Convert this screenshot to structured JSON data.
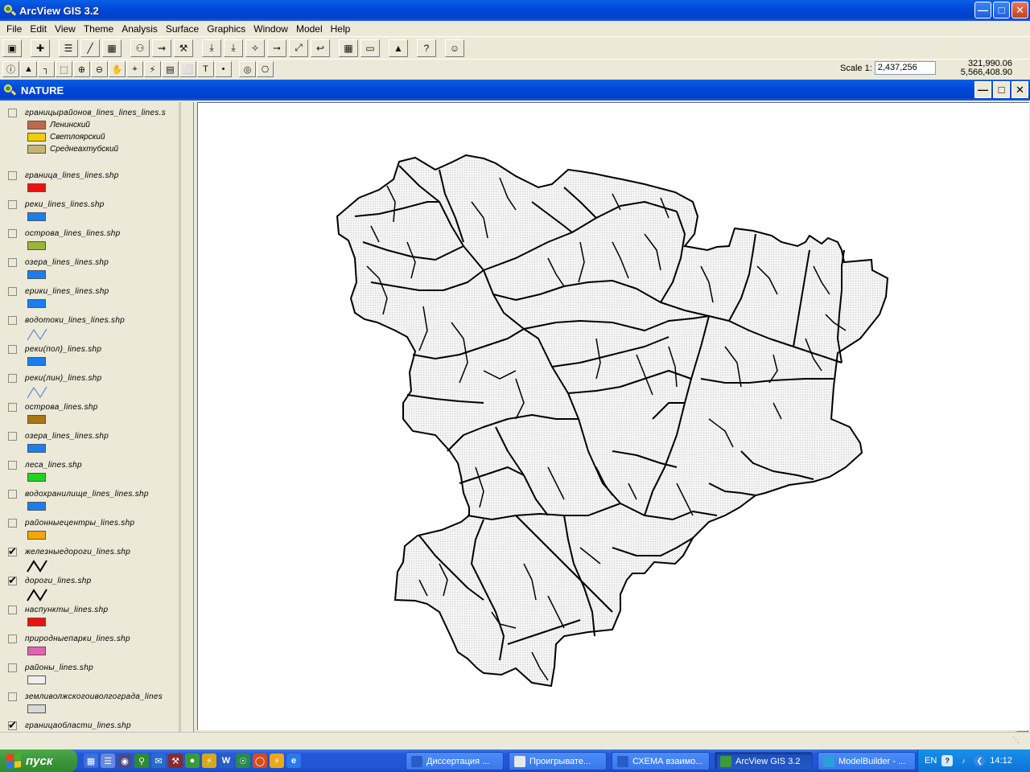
{
  "app": {
    "title": "ArcView GIS 3.2"
  },
  "menu": [
    "File",
    "Edit",
    "View",
    "Theme",
    "Analysis",
    "Surface",
    "Graphics",
    "Window",
    "Model",
    "Help"
  ],
  "toolbar1": [
    {
      "name": "save-icon",
      "glyph": "▣"
    },
    {
      "name": "add-theme-icon",
      "glyph": "✚"
    },
    {
      "name": "theme-properties-icon",
      "glyph": "☰"
    },
    {
      "name": "edit-legend-icon",
      "glyph": "╱"
    },
    {
      "name": "open-table-icon",
      "glyph": "▦"
    },
    {
      "name": "find-icon",
      "glyph": "⚇"
    },
    {
      "name": "locate-address-icon",
      "glyph": "⇝"
    },
    {
      "name": "query-builder-icon",
      "glyph": "⚒"
    },
    {
      "name": "zoom-full-extent-icon",
      "glyph": "⤓"
    },
    {
      "name": "zoom-active-themes-icon",
      "glyph": "⤓"
    },
    {
      "name": "zoom-selected-icon",
      "glyph": "✧"
    },
    {
      "name": "zoom-in-fixed-icon",
      "glyph": "⭢"
    },
    {
      "name": "zoom-out-fixed-icon",
      "glyph": "⤢"
    },
    {
      "name": "zoom-previous-icon",
      "glyph": "↩"
    },
    {
      "name": "select-by-theme-icon",
      "glyph": "▦"
    },
    {
      "name": "clear-selection-icon",
      "glyph": "▭"
    },
    {
      "name": "create-chart-icon",
      "glyph": "▲"
    },
    {
      "name": "help-icon",
      "glyph": "?"
    },
    {
      "name": "hotlink-icon",
      "glyph": "☺"
    }
  ],
  "toolbar2": [
    {
      "name": "identify-icon",
      "glyph": "ⓘ"
    },
    {
      "name": "pointer-icon",
      "glyph": "▲"
    },
    {
      "name": "vertex-edit-icon",
      "glyph": "┐"
    },
    {
      "name": "select-feature-icon",
      "glyph": "⬚"
    },
    {
      "name": "zoom-in-icon",
      "glyph": "⊕"
    },
    {
      "name": "zoom-out-icon",
      "glyph": "⊖"
    },
    {
      "name": "pan-icon",
      "glyph": "✋"
    },
    {
      "name": "measure-icon",
      "glyph": "⌖"
    },
    {
      "name": "hotlink-bolt-icon",
      "glyph": "⚡"
    },
    {
      "name": "area-of-interest-icon",
      "glyph": "▤"
    },
    {
      "name": "label-icon",
      "glyph": "⬜"
    },
    {
      "name": "text-icon",
      "glyph": "T"
    },
    {
      "name": "draw-point-icon",
      "glyph": "•"
    },
    {
      "name": "snap-icon",
      "glyph": "◎"
    },
    {
      "name": "snap-general-icon",
      "glyph": "⎔"
    }
  ],
  "scale": {
    "label": "Scale 1:",
    "value": "2,437,256"
  },
  "coords": {
    "x": "321,990.06",
    "y": "5,566,408.90"
  },
  "view": {
    "title": "NATURE"
  },
  "themes": [
    {
      "name": "границырайонов_lines_lines_lines.s",
      "checked": false,
      "type": "poly-legend",
      "legend": [
        {
          "label": "Ленинский",
          "color": "#c0684e"
        },
        {
          "label": "Светлоярский",
          "color": "#f5cc00"
        },
        {
          "label": "Среднеахтубский",
          "color": "#c8b46c"
        }
      ]
    },
    {
      "name": "граница_lines_lines.shp",
      "checked": false,
      "type": "poly",
      "color": "#ee1111"
    },
    {
      "name": "реки_lines_lines.shp",
      "checked": false,
      "type": "poly",
      "color": "#1a7ef0"
    },
    {
      "name": "острова_lines_lines.shp",
      "checked": false,
      "type": "poly",
      "color": "#9ab43a"
    },
    {
      "name": "озера_lines_lines.shp",
      "checked": false,
      "type": "poly",
      "color": "#1a7ef0"
    },
    {
      "name": "ерики_lines_lines.shp",
      "checked": false,
      "type": "poly",
      "color": "#1a7ef0"
    },
    {
      "name": "водотоки_lines_lines.shp",
      "checked": false,
      "type": "line",
      "color": "#3a7ad8"
    },
    {
      "name": "реки(пол)_lines.shp",
      "checked": false,
      "type": "poly",
      "color": "#1a7ef0"
    },
    {
      "name": "реки(лин)_lines.shp",
      "checked": false,
      "type": "line",
      "color": "#3a7ad8"
    },
    {
      "name": "острова_lines.shp",
      "checked": false,
      "type": "poly",
      "color": "#a87814"
    },
    {
      "name": "озера_lines_lines.shp",
      "checked": false,
      "type": "poly",
      "color": "#1a7ef0"
    },
    {
      "name": "леса_lines.shp",
      "checked": false,
      "type": "poly",
      "color": "#1ed41e"
    },
    {
      "name": "водохранилище_lines_lines.shp",
      "checked": false,
      "type": "poly",
      "color": "#1a7ef0"
    },
    {
      "name": "районныецентры_lines.shp",
      "checked": false,
      "type": "poly",
      "color": "#f5a800"
    },
    {
      "name": "железныедороги_lines.shp",
      "checked": true,
      "type": "line",
      "color": "#000000"
    },
    {
      "name": "дороги_lines.shp",
      "checked": true,
      "type": "line",
      "color": "#000000"
    },
    {
      "name": "нaспункты_lines.shp",
      "checked": false,
      "type": "poly",
      "color": "#ee1111"
    },
    {
      "name": "природныепарки_lines.shp",
      "checked": false,
      "type": "poly",
      "color": "#e860b4"
    },
    {
      "name": "районы_lines.shp",
      "checked": false,
      "type": "poly",
      "color": "#eeeeee"
    },
    {
      "name": "земливолжскогоиволгограда_lines",
      "checked": false,
      "type": "poly",
      "color": "#d8d8d8"
    },
    {
      "name": "границаобласти_lines.shp",
      "checked": true,
      "type": "poly",
      "color": "#ffffff"
    }
  ],
  "taskbar": {
    "start_label": "пуск",
    "tasks": [
      {
        "label": "Диссертация ...",
        "color": "#2a5cc8",
        "active": false
      },
      {
        "label": "Проигрывате...",
        "color": "#e8e8e8",
        "active": false
      },
      {
        "label": "СХЕМА взаимо...",
        "color": "#2a5cc8",
        "active": false
      },
      {
        "label": "ArcView GIS 3.2",
        "color": "#3a9c3a",
        "active": true
      },
      {
        "label": "ModelBuilder - ...",
        "color": "#2aa0d8",
        "active": false
      }
    ],
    "lang": "EN",
    "clock": "14:12"
  },
  "colors": {
    "title_blue": "#0048d8",
    "face": "#ece9d8",
    "map_fill": "#f1f1f1"
  }
}
